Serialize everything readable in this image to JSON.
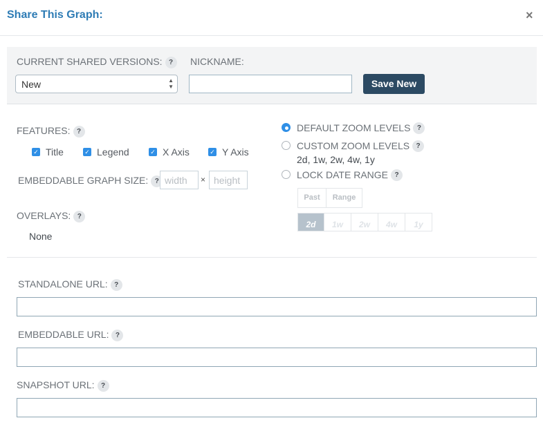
{
  "dialog": {
    "title": "Share This Graph:",
    "close_icon": "×"
  },
  "versions": {
    "label": "CURRENT SHARED VERSIONS:",
    "selected": "New",
    "nickname_label": "NICKNAME:",
    "nickname_value": "",
    "save_button": "Save New"
  },
  "help_glyph": "?",
  "features": {
    "label": "FEATURES:",
    "items": [
      {
        "label": "Title",
        "checked": true
      },
      {
        "label": "Legend",
        "checked": true
      },
      {
        "label": "X Axis",
        "checked": true
      },
      {
        "label": "Y Axis",
        "checked": true
      }
    ]
  },
  "embed_size": {
    "label": "EMBEDDABLE GRAPH SIZE:",
    "width_placeholder": "width",
    "separator": "×",
    "height_placeholder": "height"
  },
  "overlays": {
    "label": "OVERLAYS:",
    "value": "None"
  },
  "zoom": {
    "default_label": "DEFAULT ZOOM LEVELS",
    "custom_label": "CUSTOM ZOOM LEVELS",
    "custom_values": "2d, 1w, 2w, 4w, 1y",
    "lock_label": "LOCK DATE RANGE",
    "selected": "default",
    "tabs": [
      "Past",
      "Range"
    ],
    "ranges": [
      "2d",
      "1w",
      "2w",
      "4w",
      "1y"
    ],
    "active_range": "2d"
  },
  "urls": {
    "standalone_label": "STANDALONE URL:",
    "standalone_value": "",
    "embeddable_label": "EMBEDDABLE URL:",
    "embeddable_value": "",
    "snapshot_label": "SNAPSHOT URL:",
    "snapshot_value": ""
  },
  "colors": {
    "title": "#2e7cb5",
    "save_button": "#2c4a63",
    "checkbox": "#2f8fe6",
    "active_range": "#b6c2cc"
  }
}
